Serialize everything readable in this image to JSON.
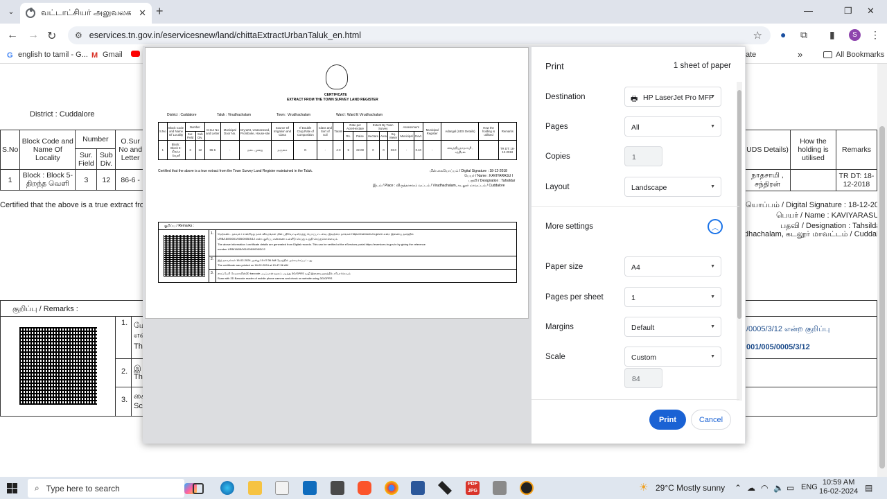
{
  "browser": {
    "tab_title": "வட்டாட்சியர் அலுவலக ஓ",
    "url": "eservices.tn.gov.in/eservicesnew/land/chittaExtractUrbanTaluk_en.html",
    "profile_initial": "S",
    "bookmarks": [
      "english to tamil - G...",
      "Gmail",
      "ate",
      "All Bookmarks"
    ]
  },
  "background_page": {
    "district": "District : Cuddalore",
    "headers": [
      "S.No",
      "Block Code and Name Of Locality",
      "Number",
      "Sur. Field",
      "Sub Div.",
      "O.Sur No and Letter",
      "UDS Details)",
      "How the holding is utilised",
      "Remarks"
    ],
    "row": [
      "1",
      "Block : Block 5- திறந்த வெளி",
      "3",
      "12",
      "86-6 -",
      "நாதசாமி , சந்திரன்",
      "TR DT: 18-12-2018"
    ],
    "certified": "Certified that the above is a true extract from",
    "digital_signature": "யொப்பம் / Digital Signature : 18-12-2018",
    "name": "பெயர் / Name : KAVIYARASU I",
    "designation": "பதவி / Designation : Tahsildar",
    "place": "dhachalam, கடலூர் மாவட்டம் / Cuddalore",
    "remarks_label": "குறிப்பு / Remarks :",
    "remarks_items": [
      "1.",
      "2.",
      "3."
    ],
    "remark_snippets": [
      "மே",
      "என",
      "The",
      "இ",
      "The",
      "கை",
      "Sca"
    ],
    "link1": "/0005/3/12 என்ற குறிப்பு",
    "link2": "001/005/0005/3/12"
  },
  "print_dialog": {
    "title": "Print",
    "sheets": "1 sheet of paper",
    "destination_label": "Destination",
    "destination_value": "HP LaserJet Pro MFP",
    "pages_label": "Pages",
    "pages_value": "All",
    "copies_label": "Copies",
    "copies_value": "1",
    "layout_label": "Layout",
    "layout_value": "Landscape",
    "more_settings": "More settings",
    "paper_size_label": "Paper size",
    "paper_size_value": "A4",
    "pages_per_sheet_label": "Pages per sheet",
    "pages_per_sheet_value": "1",
    "margins_label": "Margins",
    "margins_value": "Default",
    "scale_label": "Scale",
    "scale_value": "Custom",
    "scale_percent": "84",
    "print_button": "Print",
    "cancel_button": "Cancel"
  },
  "preview": {
    "title1": "CERTIFICATE",
    "title2": "EXTRACT FROM THE TOWN SURVEY LAND REGISTER",
    "district": "District : Cuddalore",
    "taluk": "Taluk : Virudhachalam",
    "town": "Town : Virudhachalam",
    "ward": "Ward : Ward E Virudhachalam",
    "headers": [
      "S.No",
      "Block Code and Name Of Locality",
      "Number",
      "O.Sur No and Letter",
      "Municipal Door No.",
      "Dry,Wet, Unassessed, Promboke, House-site",
      "Source Of Irrigation and Class",
      "If Double Crop,Rate of Composition",
      "Class and Sort of soil",
      "Taram",
      "Rate per Acre/Hectare",
      "Extent By Town Survey",
      "Assessment",
      "Municipal Register",
      "Adangal (UDS Details)",
      "How the holding is utilised",
      "Remarks"
    ],
    "subheaders": [
      "Sur. Field",
      "Sub Div.",
      "Rs.",
      "Paise",
      "Hectare",
      "Area",
      "Sq. Meter",
      "Municipal",
      "Govt."
    ],
    "row": [
      "1",
      "Block : Block 5- திறந்த வெளி",
      "3",
      "12",
      "86-6",
      "-",
      "நடைமுறை",
      "நஞ்சை",
      "N",
      "-",
      "4-3",
      "5",
      "22.08",
      "0",
      "0",
      "33.0",
      "-",
      "0.10",
      "-",
      "வைத்தியநாதசாமி , சந்திரன்",
      "",
      "TR DT: 18-12-2018"
    ],
    "certified": "Certified that the above is a true extract from the Town Survey Land Register maintained in the Taluk.",
    "sig": "மின் கையொப்பம் / Digital Signature : 18-12-2018",
    "name": "பெயர் / Name : KAVIYARASU I",
    "designation": "பதவி / Designation : Tahsildar",
    "place": "இடம் / Place : விருத்தாசலம் வட்டம் / Virudhachalam, கடலூர் மாவட்டம் / Cuddalore",
    "remarks": "குறிப்பு / Remarks :",
    "r1a": "மேற்கண்ட தகவல் / சான்றிதழ் நகல் விவரங்கள் மின் பதிவேட்டிலிருந்து பெறப்பட்டவை. இவற்றை தாங்கள் https://eservices.tn.gov.in என்ற இணைய தளத்தில்",
    "r1b": "URB/18/05/001/005/0005/3/12 என்ற குறிப்பு எண்ணை உள்ளீடு செய்து உறுதி செய்துகொள்ளவும்.",
    "r1c": "The above information / certificate details are generated from Digital records. This can be verified at the eServices portal https://eservices.tn.gov.in by giving the reference",
    "r1d": "number URB/18/05/001/005/0005/3/12",
    "r2a": "இத் தகவல்கள் 16-02-2024 அன்று 10:47:36 AM நேரத்தில் அச்சடிக்கப்பட்டது.",
    "r2b": "The certificate was printed on 16-02-2024 at 10:47:36 AM",
    "r3a": "கைப்பேசி கேமராவின்2D barcode படிப்பான் மூலம் படித்து 3G/GPRS வழி இணையதளத்தில் சரிபார்க்கவும்",
    "r3b": "Scan with 2D Barcode reader of mobile phone camera and check on website using 3G/GPRS"
  },
  "taskbar": {
    "search_placeholder": "Type here to search",
    "weather": "29°C  Mostly sunny",
    "lang": "ENG",
    "time": "10:59 AM",
    "date": "16-02-2024"
  }
}
